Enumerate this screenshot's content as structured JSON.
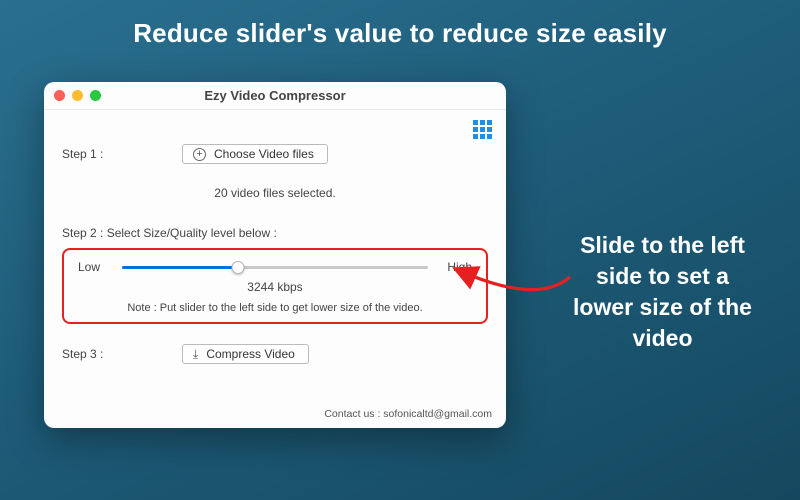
{
  "heading": "Reduce slider's value to reduce size easily",
  "callout": "Slide to the left side to set a lower size of the video",
  "window": {
    "title": "Ezy Video Compressor"
  },
  "step1": {
    "label": "Step 1 :",
    "button_label": "Choose Video files",
    "selected_text": "20 video files selected."
  },
  "step2": {
    "label": "Step 2 : Select Size/Quality level below :",
    "low": "Low",
    "high": "High",
    "bitrate": "3244 kbps",
    "note": "Note : Put slider to the left side to get lower size of the video.",
    "slider_percent": 38
  },
  "step3": {
    "label": "Step 3 :",
    "button_label": "Compress Video"
  },
  "contact": "Contact us : sofonicaltd@gmail.com"
}
